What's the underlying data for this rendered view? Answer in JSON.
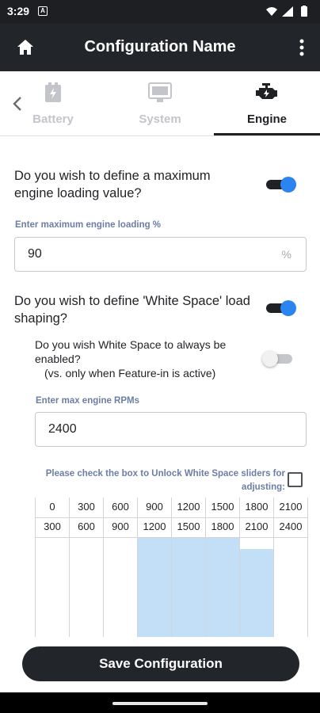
{
  "status_bar": {
    "time": "3:29",
    "notification_letter": "A"
  },
  "app_bar": {
    "title": "Configuration Name",
    "home_icon": "home-icon",
    "menu_icon": "more-vert-icon"
  },
  "tabs": [
    {
      "label": "Battery",
      "icon": "battery-icon",
      "active": false
    },
    {
      "label": "System",
      "icon": "system-display-icon",
      "active": false
    },
    {
      "label": "Engine",
      "icon": "engine-icon",
      "active": true
    }
  ],
  "engine": {
    "max_loading_question": "Do you wish to define a maximum engine loading value?",
    "max_loading_toggle": true,
    "max_loading_label": "Enter maximum engine loading %",
    "max_loading_value": "90",
    "max_loading_suffix": "%",
    "white_space_question": "Do you wish to define 'White Space' load shaping?",
    "white_space_toggle": true,
    "always_enabled_question": "Do you wish White Space to always be enabled?",
    "always_enabled_note": "(vs. only when Feature-in is active)",
    "always_enabled_toggle": false,
    "max_rpm_label": "Enter max engine RPMs",
    "max_rpm_value": "2400",
    "unlock_label": "Please check the box to Unlock White Space sliders for adjusting:",
    "unlock_checked": false
  },
  "rpm_bands": [
    {
      "from": "0",
      "to": "300",
      "level": 0
    },
    {
      "from": "300",
      "to": "600",
      "level": 0
    },
    {
      "from": "600",
      "to": "900",
      "level": 0
    },
    {
      "from": "900",
      "to": "1200",
      "level": 1.0
    },
    {
      "from": "1200",
      "to": "1500",
      "level": 1.0
    },
    {
      "from": "1500",
      "to": "1800",
      "level": 1.0
    },
    {
      "from": "1800",
      "to": "2100",
      "level": 0.88
    },
    {
      "from": "2100",
      "to": "2400",
      "level": 0
    }
  ],
  "colors": {
    "accent": "#2c84f1",
    "dark": "#22252a",
    "label": "#6c7ea4",
    "band_fill": "#c2dff7"
  },
  "save_button": "Save Configuration"
}
